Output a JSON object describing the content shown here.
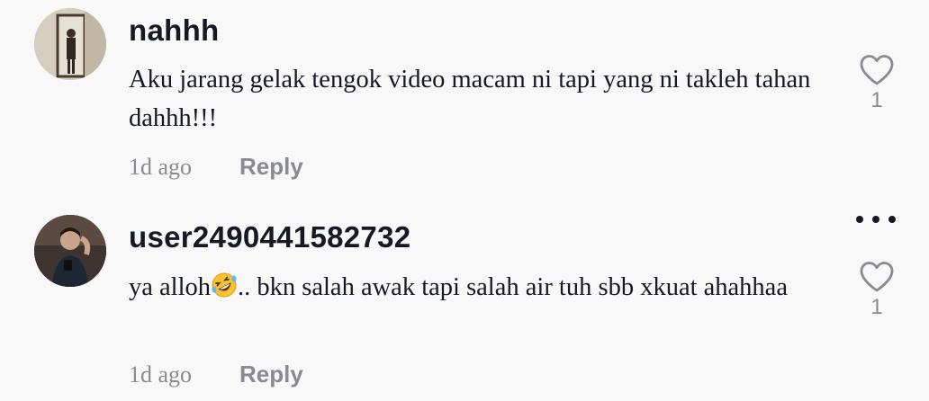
{
  "comments": [
    {
      "username": "nahhh",
      "text": "Aku jarang gelak tengok video macam ni tapi yang ni takleh tahan dahhh!!!",
      "time": "1d ago",
      "reply_label": "Reply",
      "like_count": "1",
      "icons": {
        "avatar": "user-avatar",
        "like": "heart-outline-icon"
      }
    },
    {
      "username": "user2490441582732",
      "text_before_emoji": "ya alloh",
      "emoji": "rolling-on-floor-laughing-emoji",
      "text_after_emoji": ".. bkn salah awak tapi salah air tuh sbb xkuat ahahhaa",
      "time": "1d ago",
      "reply_label": "Reply",
      "like_count": "1",
      "icons": {
        "avatar": "user-avatar",
        "like": "heart-outline-icon",
        "more": "more-options-icon"
      }
    }
  ],
  "colors": {
    "background": "#f8f8f8",
    "primary_text": "#161823",
    "secondary_text": "#8a8b91"
  }
}
